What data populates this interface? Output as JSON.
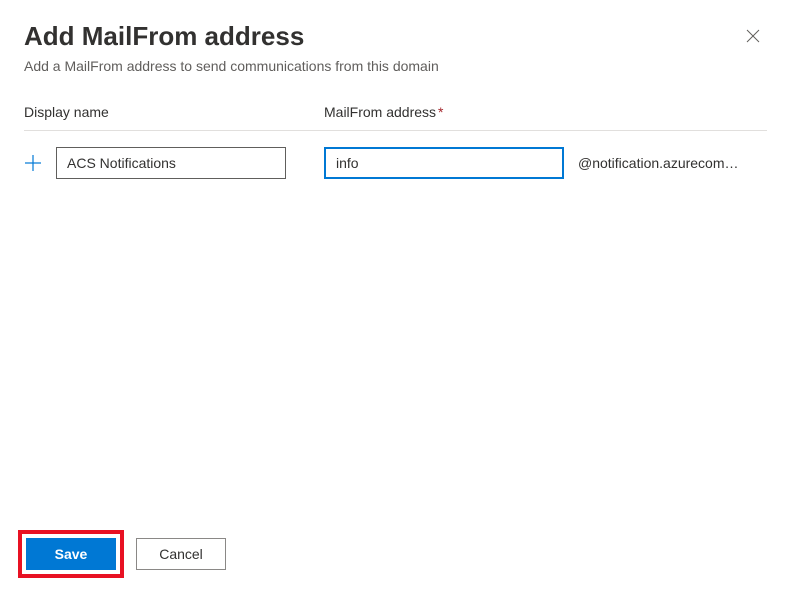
{
  "header": {
    "title": "Add MailFrom address",
    "subtitle": "Add a MailFrom address to send communications from this domain"
  },
  "form": {
    "display_name_label": "Display name",
    "mailfrom_label": "MailFrom address",
    "required_marker": "*",
    "display_name_value": "ACS Notifications",
    "mailfrom_value": "info",
    "domain_suffix": "@notification.azurecom…"
  },
  "footer": {
    "save_label": "Save",
    "cancel_label": "Cancel"
  }
}
